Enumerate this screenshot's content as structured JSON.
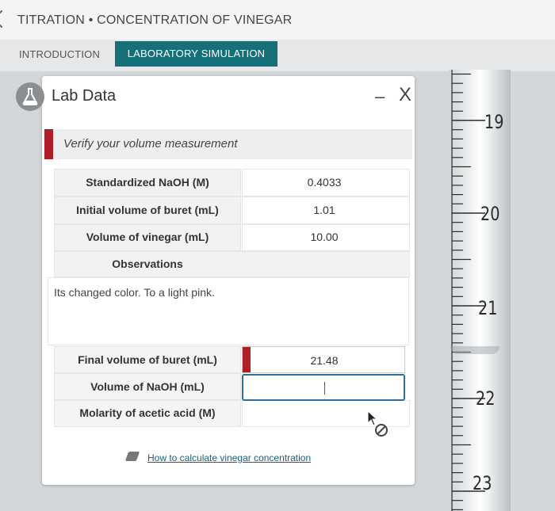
{
  "app": {
    "title": "TITRATION • CONCENTRATION OF VINEGAR"
  },
  "tabs": [
    {
      "label": "INTRODUCTION",
      "active": false
    },
    {
      "label": "LABORATORY SIMULATION",
      "active": true
    }
  ],
  "panel": {
    "title": "Lab Data",
    "minimize_label": "–",
    "close_label": "X",
    "verify_message": "Verify your volume measurement",
    "rows": [
      {
        "label": "Standardized NaOH (M)",
        "value": "0.4033"
      },
      {
        "label": "Initial volume of buret (mL)",
        "value": "1.01"
      },
      {
        "label": "Volume of vinegar (mL)",
        "value": "10.00"
      }
    ],
    "observations_header": "Observations",
    "observations_text": "Its changed color. To a light pink.",
    "final_volume": {
      "label": "Final volume of buret (mL)",
      "value": "21.48"
    },
    "naoh_volume": {
      "label": "Volume of NaOH (mL)",
      "value": ""
    },
    "molarity": {
      "label": "Molarity of acetic acid (M)",
      "value": ""
    },
    "help_link": "How to calculate vinegar concentration"
  },
  "buret": {
    "labels": [
      "19",
      "20",
      "21",
      "22",
      "23"
    ]
  },
  "colors": {
    "tab_active": "#16707a",
    "flag": "#b01e27",
    "input_focus": "#2a6f9f",
    "link": "#1c5e7c"
  }
}
